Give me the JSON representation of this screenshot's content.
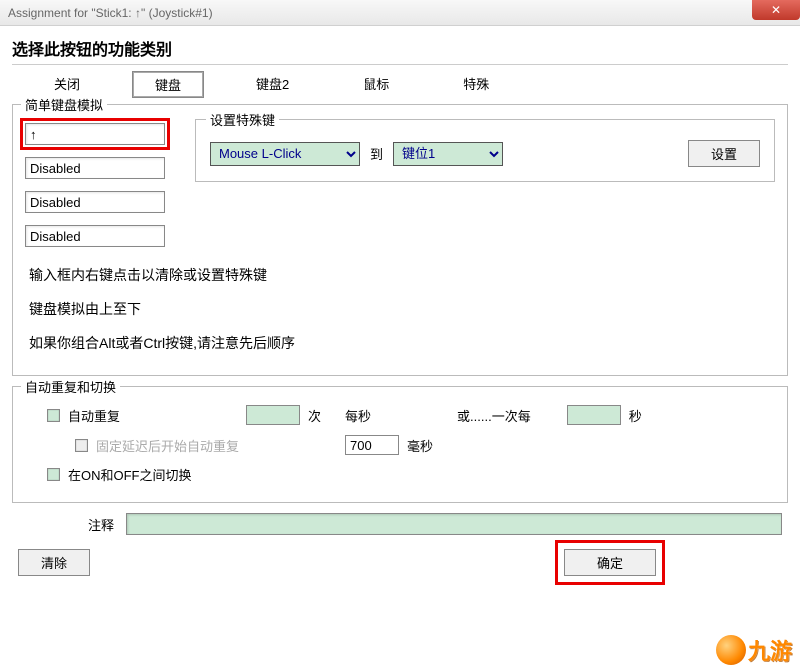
{
  "window": {
    "title": "Assignment for \"Stick1: ↑\" (Joystick#1)",
    "close_glyph": "✕"
  },
  "heading": "选择此按钮的功能类别",
  "tabs": {
    "close": "关闭",
    "keyboard": "键盘",
    "keyboard2": "键盘2",
    "mouse": "鼠标",
    "special": "特殊"
  },
  "simple": {
    "legend": "简单键盘模拟",
    "keys": [
      "↑",
      "Disabled",
      "Disabled",
      "Disabled"
    ]
  },
  "specialKeys": {
    "legend": "设置特殊键",
    "select1": "Mouse L-Click",
    "to": "到",
    "select2": "键位1",
    "set": "设置"
  },
  "info": {
    "l1": "输入框内右键点击以清除或设置特殊键",
    "l2": "键盘模拟由上至下",
    "l3": "如果你组合Alt或者Ctrl按键,请注意先后顺序"
  },
  "auto": {
    "legend": "自动重复和切换",
    "autorepeat": "自动重复",
    "times": "次",
    "persec": "每秒",
    "or_every": "或......一次每",
    "sec": "秒",
    "fixed": "固定延迟后开始自动重复",
    "delay_val": "700",
    "ms": "毫秒",
    "toggle": "在ON和OFF之间切换"
  },
  "footer": {
    "comment": "注释",
    "clear": "清除",
    "ok": "确定"
  },
  "logo": {
    "text": "九游"
  }
}
